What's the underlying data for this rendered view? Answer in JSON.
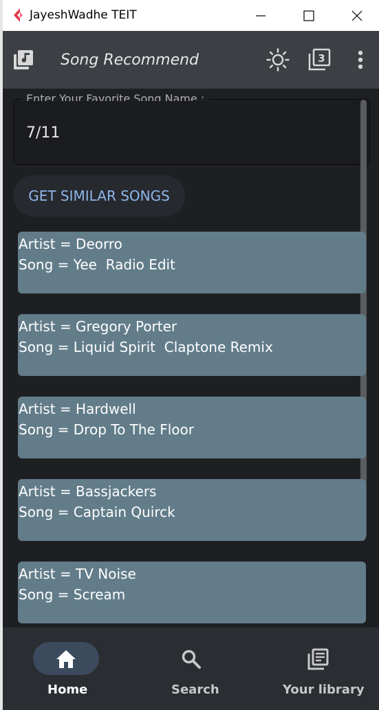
{
  "window": {
    "title": "JayeshWadhe TEIT"
  },
  "appbar": {
    "title": "Song Recommend",
    "icons": [
      "music-library-icon",
      "brightness-icon",
      "filter-3-icon",
      "more-vert-icon"
    ]
  },
  "input": {
    "label": "Enter Your Favorite Song Name :",
    "value": "7/11"
  },
  "action": {
    "label": "GET SIMILAR SONGS"
  },
  "results": [
    {
      "artist": "Artist = Deorro",
      "song": "Song = Yee  Radio Edit"
    },
    {
      "artist": "Artist = Gregory Porter",
      "song": "Song = Liquid Spirit  Claptone Remix"
    },
    {
      "artist": "Artist = Hardwell",
      "song": "Song = Drop To The Floor"
    },
    {
      "artist": "Artist = Bassjackers",
      "song": "Song = Captain Quirck"
    },
    {
      "artist": "Artist = TV Noise",
      "song": "Song = Scream"
    }
  ],
  "nav": {
    "items": [
      {
        "label": "Home",
        "icon": "home-icon",
        "active": true
      },
      {
        "label": "Search",
        "icon": "search-icon",
        "active": false
      },
      {
        "label": "Your library",
        "icon": "library-icon",
        "active": false
      }
    ]
  },
  "colors": {
    "appbar": "#3c3f44",
    "background": "#1d1f22",
    "card": "#627c89",
    "accent": "#8fb6ea",
    "nav_active_pill": "#3c4a5e"
  }
}
